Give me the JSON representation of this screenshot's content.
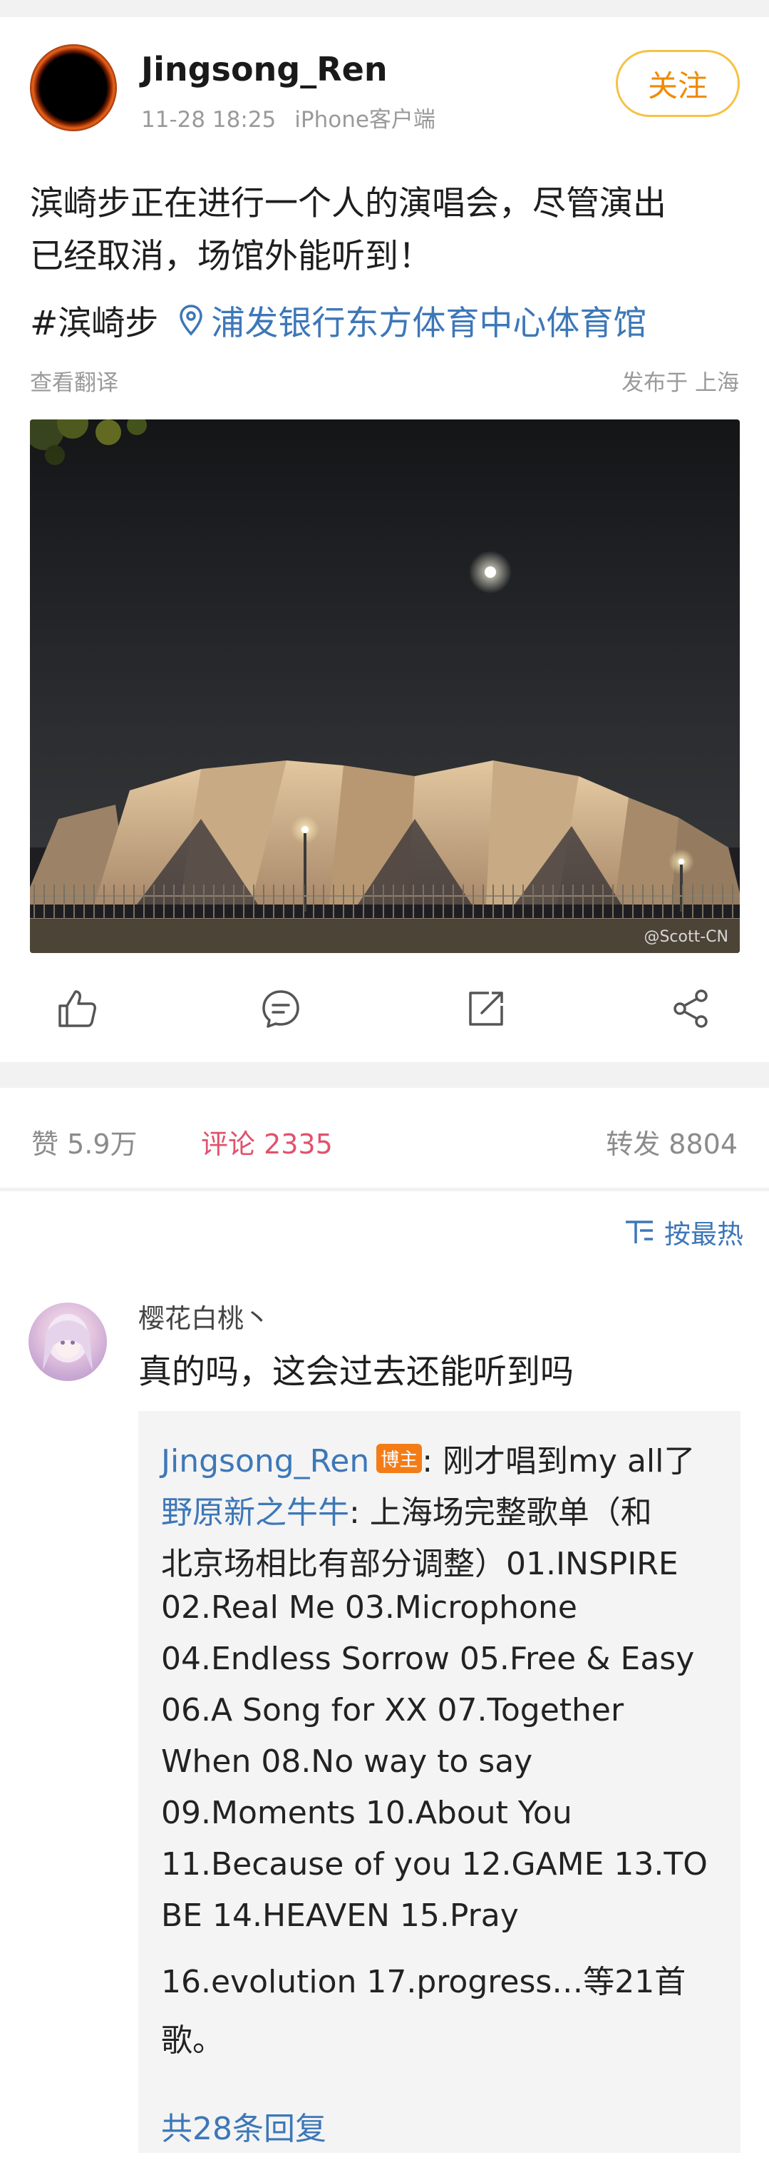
{
  "post": {
    "username": "Jingsong_Ren",
    "time": "11-28 18:25",
    "client": "iPhone客户端",
    "follow_label": "关注",
    "text_line1": "滨崎步正在进行一个人的演唱会，尽管演出",
    "text_line2": "已经取消，场馆外能听到！",
    "hashtag": "#滨崎步",
    "location": "浦发银行东方体育中心体育馆",
    "translate_label": "查看翻译",
    "publish_location": "发布于 上海",
    "image_watermark": "@Scott-CN"
  },
  "actions": {
    "like": "like-icon",
    "comment": "comment-icon",
    "share": "share-icon",
    "more": "more-share-icon"
  },
  "stats": {
    "likes": "赞 5.9万",
    "comments": "评论 2335",
    "reposts": "转发 8804"
  },
  "comments": {
    "sort_label": "按最热",
    "items": [
      {
        "name": "樱花白桃丶",
        "text": "真的吗，这会过去还能听到吗",
        "replies": [
          {
            "author": "Jingsong_Ren",
            "badge": "博主",
            "text": ": 刚才唱到my all了"
          },
          {
            "author": "野原新之牛牛",
            "text": ": 上海场完整歌单（和"
          }
        ],
        "reply_continuation": [
          "北京场相比有部分调整）01.INSPIRE",
          "02.Real Me 03.Microphone",
          "04.Endless Sorrow 05.Free & Easy",
          "06.A Song for XX 07.Together",
          "When 08.No way to say",
          "09.Moments 10.About You",
          "11.Because of you 12.GAME 13.TO",
          "BE 14.HEAVEN 15.Pray",
          "16.evolution 17.progress…等21首",
          "歌。"
        ],
        "reply_count_label": "共28条回复"
      }
    ]
  },
  "colors": {
    "link": "#3d77b8",
    "follow_border": "#f6c243",
    "follow_text": "#f08a00",
    "comment_stat": "#e0526c",
    "badge": "#f47c17"
  }
}
